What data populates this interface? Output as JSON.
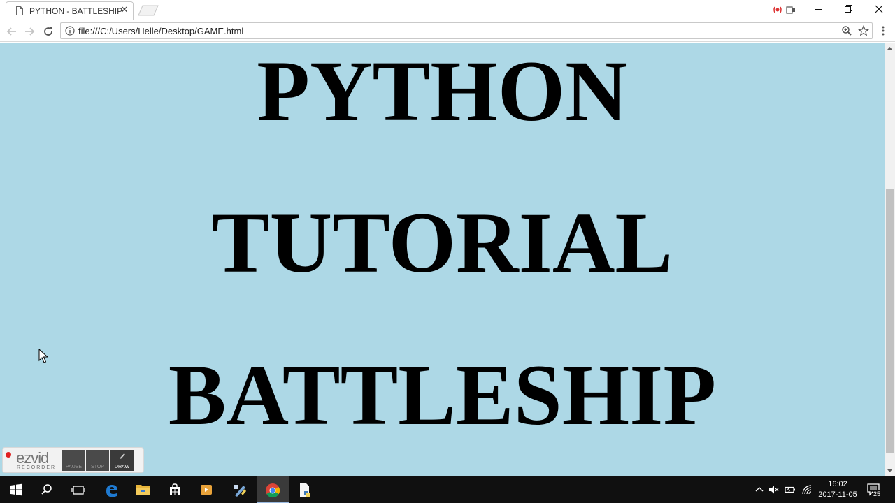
{
  "browser": {
    "tab_title": "PYTHON - BATTLESHIP",
    "url": "file:///C:/Users/Helle/Desktop/GAME.html"
  },
  "page": {
    "background": "#add8e6",
    "headings": [
      "PYTHON",
      "TUTORIAL",
      "BATTLESHIP"
    ]
  },
  "recorder": {
    "logo": "ezvid",
    "subtitle": "RECORDER",
    "buttons": [
      "PAUSE",
      "STOP",
      "DRAW"
    ]
  },
  "taskbar": {
    "time": "16:02",
    "date": "2017-11-05",
    "notification_count": "25"
  },
  "colors": {
    "accent_active": "#99b9e0",
    "recording": "#e02020"
  },
  "icons": [
    "page-icon",
    "close-icon",
    "back-icon",
    "forward-icon",
    "reload-icon",
    "info-icon",
    "zoom-icon",
    "star-icon",
    "menu-icon",
    "windows-icon",
    "search-icon",
    "task-view-icon",
    "edge-icon",
    "folder-icon",
    "store-icon",
    "media-icon",
    "python-icon",
    "chrome-icon",
    "file-icon"
  ]
}
